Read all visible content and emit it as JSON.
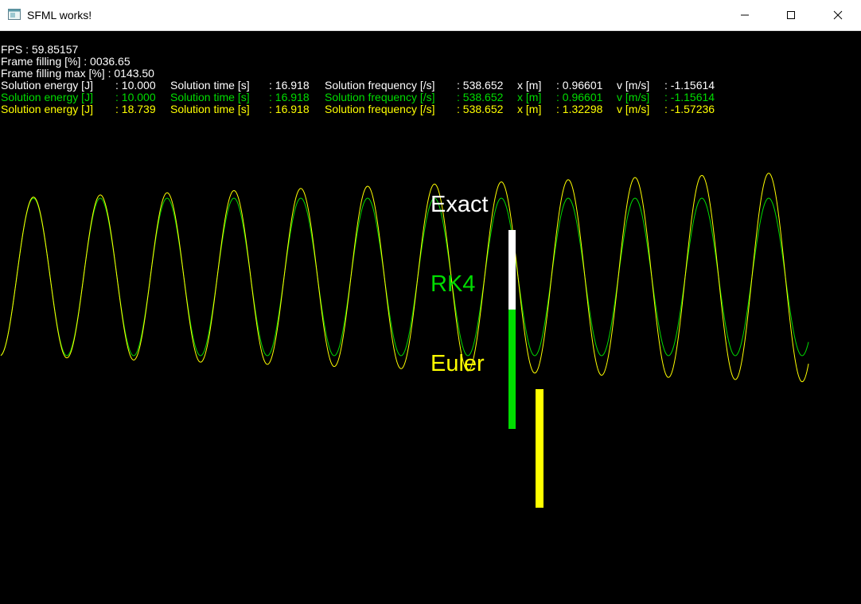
{
  "window": {
    "title": "SFML works!",
    "icons": {
      "app": "app-window-icon",
      "minimize": "minimize-icon",
      "maximize": "maximize-icon",
      "close": "close-icon"
    }
  },
  "stats": {
    "fps": "FPS : 59.85157",
    "frame_filling": "Frame filling [%] : 0036.65",
    "frame_filling_max": "Frame filling max [%] : 0143.50"
  },
  "rows": [
    {
      "solver": "Exact",
      "color": "#ffffff",
      "energy_label": "Solution energy [J]",
      "energy": ": 10.000",
      "time_label": "Solution time [s]",
      "time": ": 16.918",
      "freq_label": "Solution frequency [/s]",
      "freq": ": 538.652",
      "x_label": "x [m]",
      "x": ": 0.96601",
      "v_label": "v [m/s]",
      "v": ": -1.15614"
    },
    {
      "solver": "RK4",
      "color": "#00dd00",
      "energy_label": "Solution energy [J]",
      "energy": ": 10.000",
      "time_label": "Solution time [s]",
      "time": ": 16.918",
      "freq_label": "Solution frequency [/s]",
      "freq": ": 538.652",
      "x_label": "x [m]",
      "x": ": 0.96601",
      "v_label": "v [m/s]",
      "v": ": -1.15614"
    },
    {
      "solver": "Euler",
      "color": "#ffff00",
      "energy_label": "Solution energy [J]",
      "energy": ": 18.739",
      "time_label": "Solution time [s]",
      "time": ": 16.918",
      "freq_label": "Solution frequency [/s]",
      "freq": ": 538.652",
      "x_label": "x [m]",
      "x": ": 1.32298",
      "v_label": "v [m/s]",
      "v": ": -1.57236"
    }
  ],
  "legend": {
    "exact": "Exact",
    "rk4": "RK4",
    "euler": "Euler"
  },
  "colors": {
    "exact": "#ffffff",
    "rk4": "#00dd00",
    "euler": "#ffff00",
    "background": "#000000"
  }
}
